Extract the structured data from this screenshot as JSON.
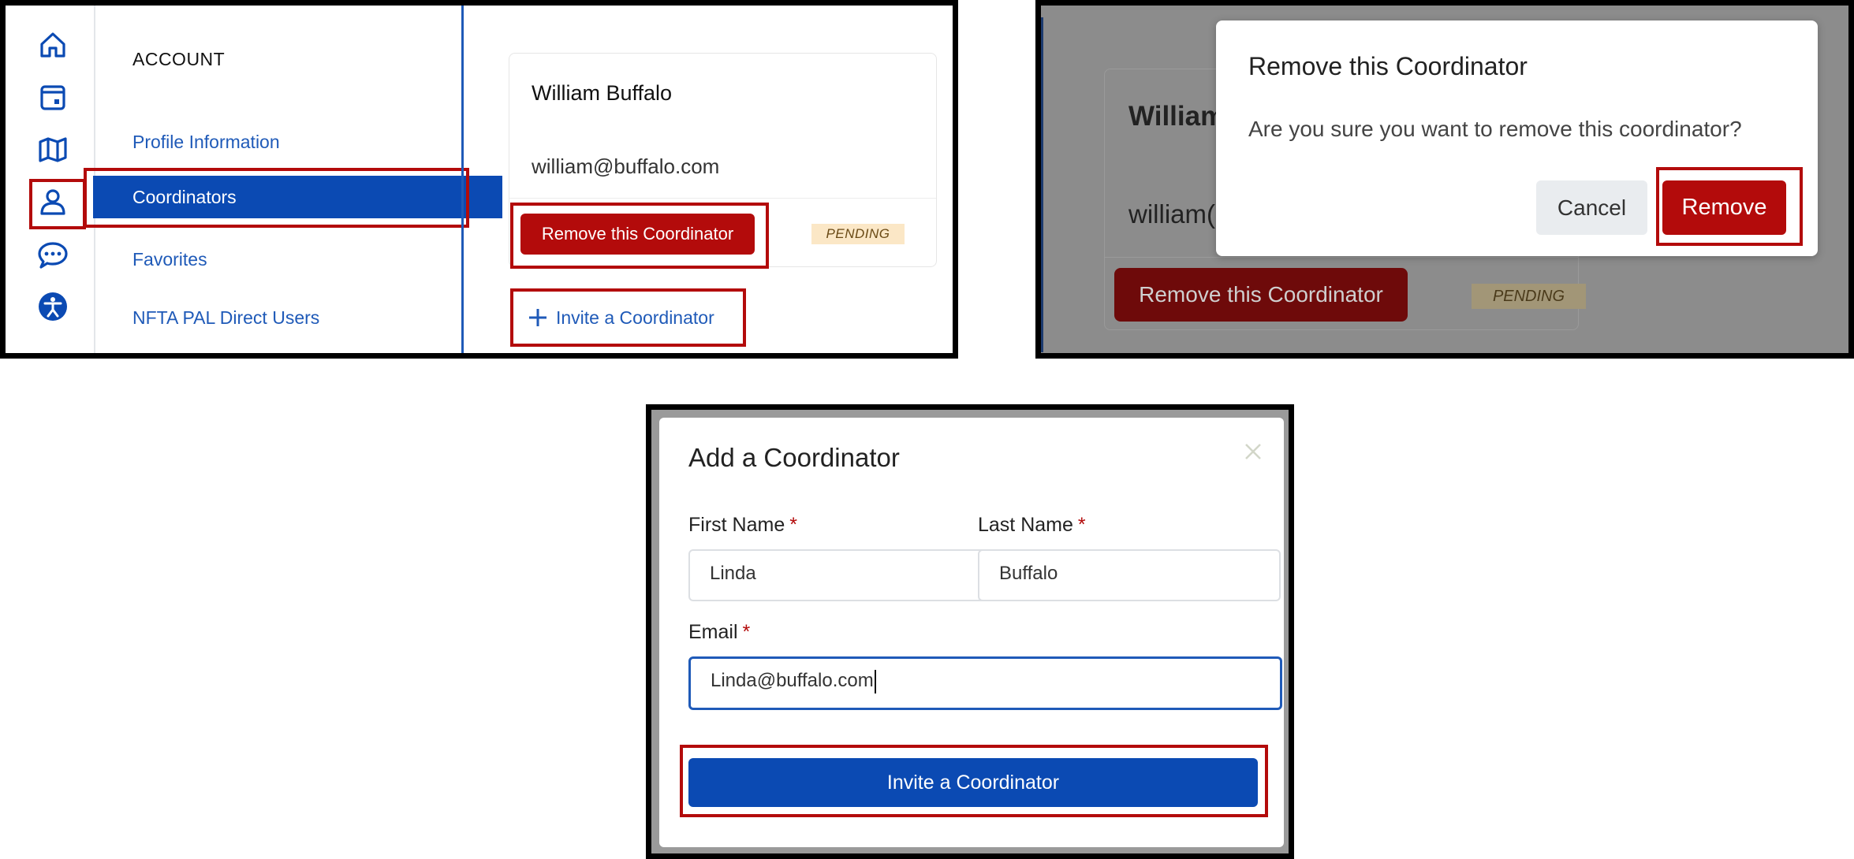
{
  "panel1": {
    "sidebar_icons": [
      "home-icon",
      "calendar-icon",
      "map-icon",
      "user-icon",
      "chat-icon",
      "accessibility-icon"
    ],
    "menu_title": "ACCOUNT",
    "menu_items": [
      {
        "label": "Profile Information"
      },
      {
        "label": "Coordinators"
      },
      {
        "label": "Favorites"
      },
      {
        "label": "NFTA PAL Direct Users"
      }
    ],
    "coordinator_card": {
      "name": "William Buffalo",
      "email": "william@buffalo.com",
      "remove_label": "Remove this Coordinator",
      "status": "PENDING"
    },
    "invite_link": {
      "icon": "plus-icon",
      "label": "Invite a Coordinator"
    }
  },
  "panel2": {
    "background_card": {
      "name": "William",
      "email": "william(",
      "remove_label": "Remove this Coordinator",
      "status": "PENDING"
    },
    "dialog": {
      "title": "Remove this Coordinator",
      "message": "Are you sure you want to remove this coordinator?",
      "cancel_label": "Cancel",
      "confirm_label": "Remove"
    }
  },
  "panel3": {
    "modal": {
      "title": "Add a Coordinator",
      "close_icon": "close-icon",
      "first_name": {
        "label": "First Name",
        "required_mark": "*",
        "value": "Linda"
      },
      "last_name": {
        "label": "Last Name",
        "required_mark": "*",
        "value": "Buffalo"
      },
      "email": {
        "label": "Email",
        "required_mark": "*",
        "value": "Linda@buffalo.com"
      },
      "submit_label": "Invite a Coordinator"
    }
  },
  "colors": {
    "brand_blue": "#0b4ab3",
    "brand_red": "#b30b0b",
    "pending_bg": "#fbe7c6",
    "highlight_box": "#b30b0b"
  }
}
